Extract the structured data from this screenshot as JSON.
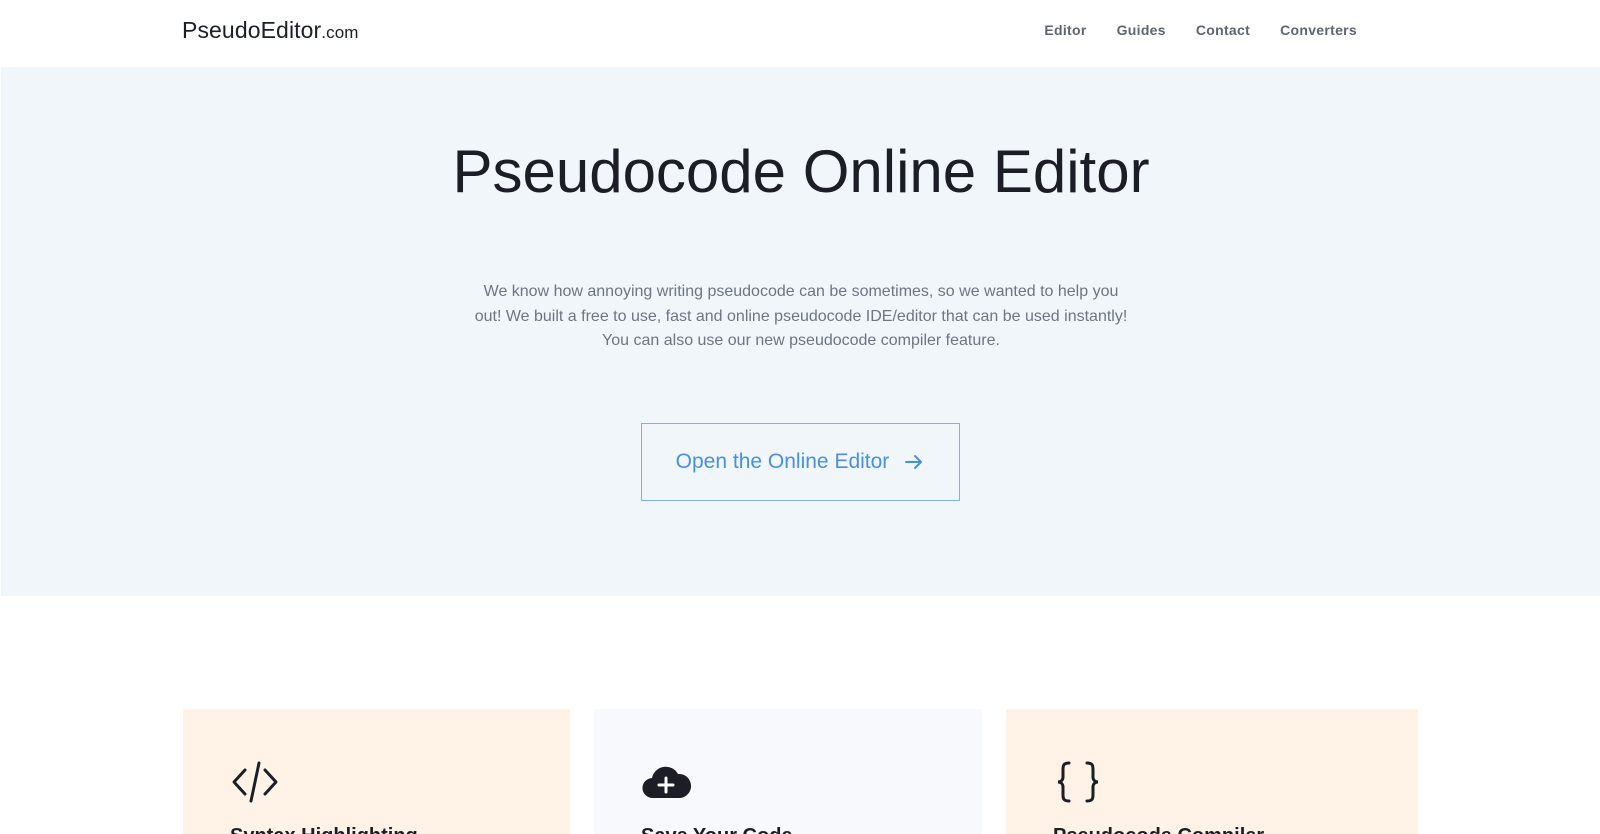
{
  "header": {
    "logo_main": "PseudoEditor",
    "logo_tld": ".com",
    "nav": [
      {
        "label": "Editor"
      },
      {
        "label": "Guides"
      },
      {
        "label": "Contact"
      },
      {
        "label": "Converters"
      }
    ]
  },
  "hero": {
    "title": "Pseudocode Online Editor",
    "description": "We know how annoying writing pseudocode can be sometimes, so we wanted to help you out! We built a free to use, fast and online pseudocode IDE/editor that can be used instantly! You can also use our new pseudocode compiler feature.",
    "cta_label": "Open the Online Editor",
    "cta_icon": "arrow-right-icon"
  },
  "features": [
    {
      "icon": "code-tag-icon",
      "title": "Syntax Highlighting"
    },
    {
      "icon": "cloud-plus-icon",
      "title": "Save Your Code"
    },
    {
      "icon": "curly-braces-icon",
      "title": "Pseudocode Compiler"
    }
  ],
  "colors": {
    "hero_bg": "#f1f6fb",
    "accent": "#4a90e2",
    "card_warm": "#fff3e8",
    "card_cool": "#f7f9fc"
  }
}
